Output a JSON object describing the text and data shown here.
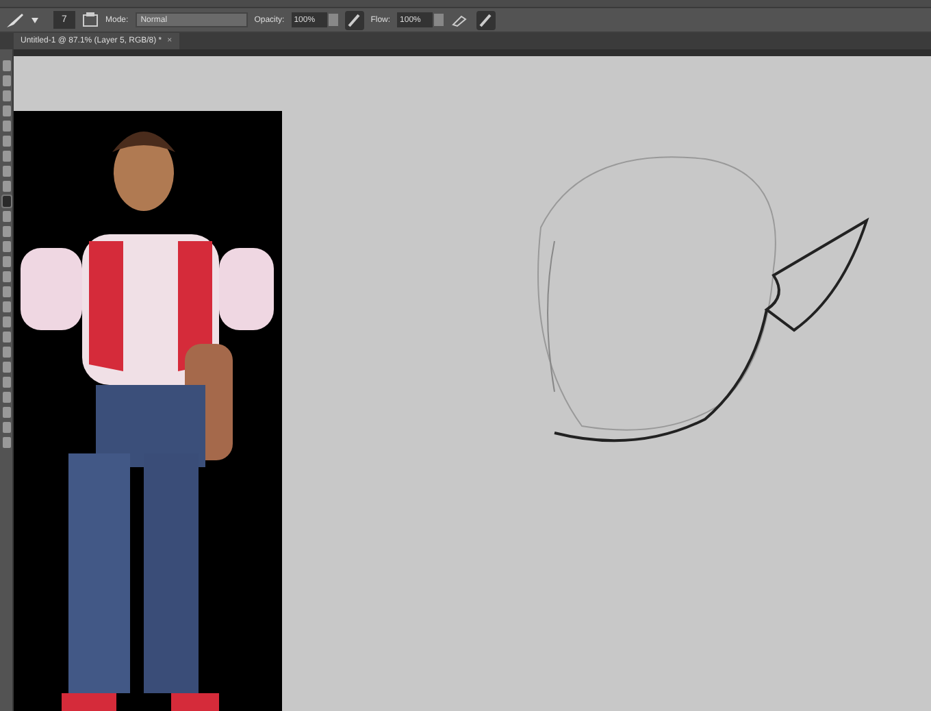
{
  "options_bar": {
    "brush_size": "7",
    "mode_label": "Mode:",
    "mode": "Normal",
    "opacity_label": "Opacity:",
    "opacity": "100%",
    "flow_label": "Flow:",
    "flow": "100%"
  },
  "document_tab": {
    "title": "Untitled-1 @ 87.1% (Layer 5, RGB/8) *",
    "close": "×"
  },
  "tools": [
    {
      "selected": false
    },
    {
      "selected": false
    },
    {
      "selected": false
    },
    {
      "selected": false
    },
    {
      "selected": false
    },
    {
      "selected": false
    },
    {
      "selected": false
    },
    {
      "selected": false
    },
    {
      "selected": false
    },
    {
      "selected": true
    },
    {
      "selected": false
    },
    {
      "selected": false
    },
    {
      "selected": false
    },
    {
      "selected": false
    },
    {
      "selected": false
    },
    {
      "selected": false
    },
    {
      "selected": false
    },
    {
      "selected": false
    },
    {
      "selected": false
    },
    {
      "selected": false
    },
    {
      "selected": false
    },
    {
      "selected": false
    },
    {
      "selected": false
    },
    {
      "selected": false
    },
    {
      "selected": false
    },
    {
      "selected": false
    }
  ]
}
